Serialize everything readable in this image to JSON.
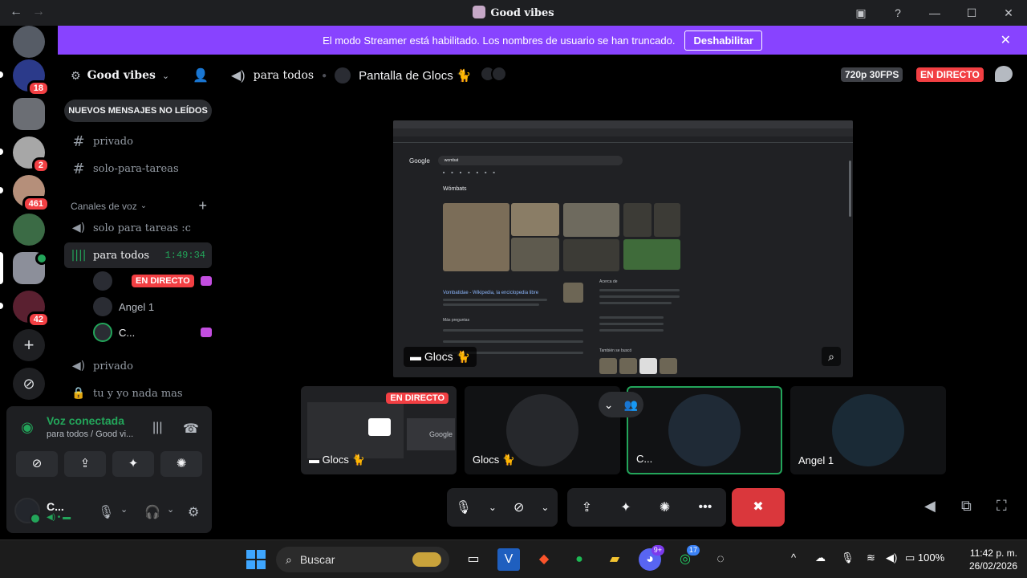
{
  "window": {
    "title": "Good vibes"
  },
  "servers": [
    {
      "badge": ""
    },
    {
      "badge": "18"
    },
    {
      "badge": ""
    },
    {
      "badge": "2"
    },
    {
      "badge": "461"
    },
    {
      "badge": ""
    },
    {
      "badge": ""
    },
    {
      "badge": "42"
    }
  ],
  "banner": {
    "text": "El modo Streamer está habilitado. Los nombres de usuario se han truncado.",
    "button": "Deshabilitar"
  },
  "guild": {
    "name": "Good vibes"
  },
  "new_messages": "NUEVOS MENSAJES NO LEÍDOS",
  "text_channels": [
    "privado",
    "solo-para-tareas"
  ],
  "voice_section": "Canales de voz",
  "voice_channels": {
    "c1": "solo para tareas :c",
    "c2": "para todos",
    "c2_time": "1:49:34",
    "c3": "privado",
    "c4": "tu y yo nada mas"
  },
  "voice_users": {
    "u1_live": "EN DIRECTO",
    "u2": "Angel 1",
    "u3": "C..."
  },
  "connection": {
    "status": "Voz conectada",
    "channel": "para todos / Good vi..."
  },
  "user": {
    "name": "C..."
  },
  "stage": {
    "channel": "para todos",
    "title": "Pantalla de Glocs 🐈",
    "quality": "720p 30FPS",
    "live": "EN DIRECTO"
  },
  "stream": {
    "label": "Glocs 🐈",
    "google": {
      "logo": "Google",
      "query": "wombat",
      "title": "Wómbats",
      "result_link": "Vombatidae - Wikipedia, la enciclopedia libre",
      "about": "Acerca de",
      "more_q": "Más preguntas",
      "also": "También se buscó"
    }
  },
  "tiles": [
    {
      "label": "Glocs 🐈",
      "live": "EN DIRECTO"
    },
    {
      "label": "Glocs 🐈"
    },
    {
      "label": "C..."
    },
    {
      "label": "Angel 1"
    }
  ],
  "tile_overlay_text": "Google",
  "taskbar": {
    "search": "Buscar",
    "discord_badge": "9+",
    "whatsapp_badge": "17",
    "battery": "100%",
    "time": "11:42 p. m.",
    "date": "26/02/2026"
  },
  "colors": {
    "accent": "#8843ff",
    "live": "#f23f43",
    "connected": "#23a55a",
    "end_call": "#da373c"
  }
}
